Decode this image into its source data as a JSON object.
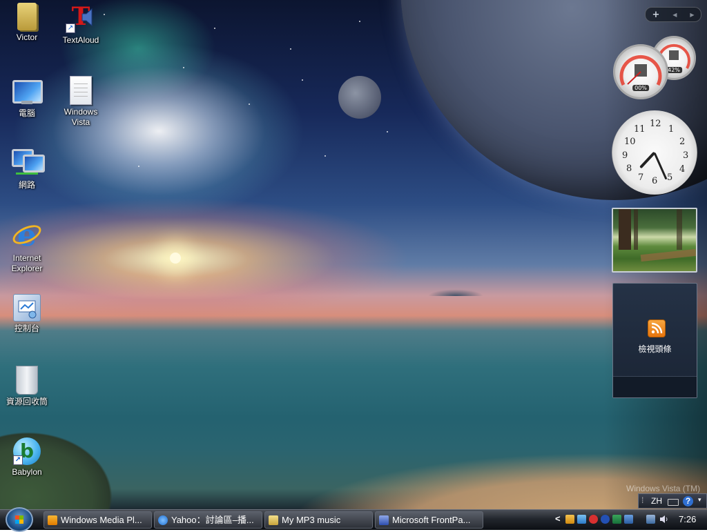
{
  "desktop": {
    "icons": [
      {
        "label": "Victor"
      },
      {
        "label": "TextAloud"
      },
      {
        "label": "電腦"
      },
      {
        "label": "Windows Vista"
      },
      {
        "label": "網路"
      },
      {
        "label": "Internet Explorer"
      },
      {
        "label": "控制台"
      },
      {
        "label": "資源回收筒"
      },
      {
        "label": "Babylon"
      }
    ],
    "watermark": "Windows Vista (TM)"
  },
  "sidebar": {
    "add_glyph": "+",
    "prev_glyph": "◀",
    "next_glyph": "▶",
    "cpu_meter": {
      "value": "00%",
      "fill_fraction": 0.0
    },
    "memory_meter": {
      "value": "42%",
      "fill_fraction": 0.42
    },
    "clock": {
      "numbers": [
        "12",
        "1",
        "2",
        "3",
        "4",
        "5",
        "6",
        "7",
        "8",
        "9",
        "10",
        "11"
      ],
      "time": "7:26"
    },
    "feed": {
      "label": "檢視頭條"
    }
  },
  "language_bar": {
    "lang": "ZH",
    "help_glyph": "?"
  },
  "taskbar": {
    "tasks": [
      {
        "label": "Windows Media Pl..."
      },
      {
        "label": "Yahoo：討論區–播..."
      },
      {
        "label": "My MP3 music"
      },
      {
        "label": "Microsoft FrontPa..."
      }
    ],
    "tray": {
      "expand_glyph": "<",
      "time": "7:26"
    }
  },
  "colors": {
    "taskbar": "#22262d",
    "accent": "#2d7fdc",
    "feed_icon": "#f39a2b"
  }
}
